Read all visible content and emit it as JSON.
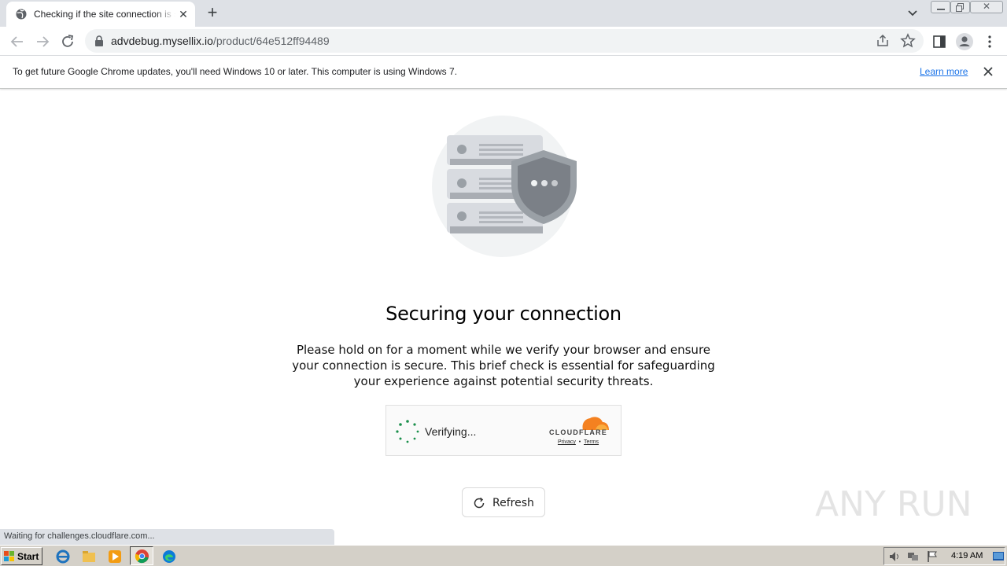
{
  "browser": {
    "tab_title": "Checking if the site connection is secure",
    "url_host": "advdebug.mysellix.io",
    "url_path": "/product/64e512ff94489"
  },
  "infobar": {
    "message": "To get future Google Chrome updates, you'll need Windows 10 or later. This computer is using Windows 7.",
    "learn_more": "Learn more"
  },
  "page": {
    "heading": "Securing your connection",
    "paragraph": "Please hold on for a moment while we verify your browser and ensure your connection is secure. This brief check is essential for safeguarding your experience against potential security threats.",
    "widget": {
      "status": "Verifying...",
      "brand": "CLOUDFLARE",
      "privacy": "Privacy",
      "separator": "•",
      "terms": "Terms"
    },
    "refresh_label": "Refresh"
  },
  "watermark": "ANY RUN",
  "status_bar": "Waiting for challenges.cloudflare.com...",
  "taskbar": {
    "start_label": "Start",
    "clock": "4:19 AM"
  },
  "colors": {
    "cloudflare_orange": "#f48120",
    "spinner_green": "#1a8f4b",
    "link_blue": "#1a73e8"
  }
}
